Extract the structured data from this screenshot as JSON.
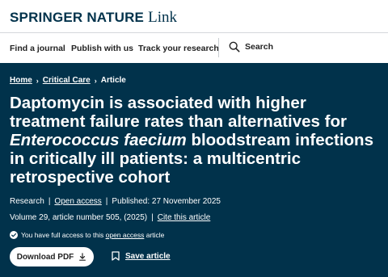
{
  "header": {
    "brand": "SPRINGER NATURE",
    "brand_suffix": "Link"
  },
  "nav": {
    "items": [
      "Find a journal",
      "Publish with us",
      "Track your research"
    ],
    "search_label": "Search"
  },
  "breadcrumb": {
    "home": "Home",
    "section": "Critical Care",
    "current": "Article"
  },
  "article": {
    "title_before": "Daptomycin is associated with higher treatment failure rates than alternatives for ",
    "title_italic": "Enterococcus faecium",
    "title_after": " bloodstream infections in critically ill patients: a multicentric retrospective cohort",
    "type": "Research",
    "access_label": "Open access",
    "published": "Published: 27 November 2025",
    "volume": "Volume 29, article number 505, (2025)",
    "cite_label": "Cite this article",
    "access_note_before": "You have full access to this ",
    "access_note_link": "open access",
    "access_note_after": " article"
  },
  "actions": {
    "download_label": "Download PDF",
    "save_label": "Save article"
  },
  "colors": {
    "hero_bg": "#01324b",
    "brand": "#01324b"
  }
}
